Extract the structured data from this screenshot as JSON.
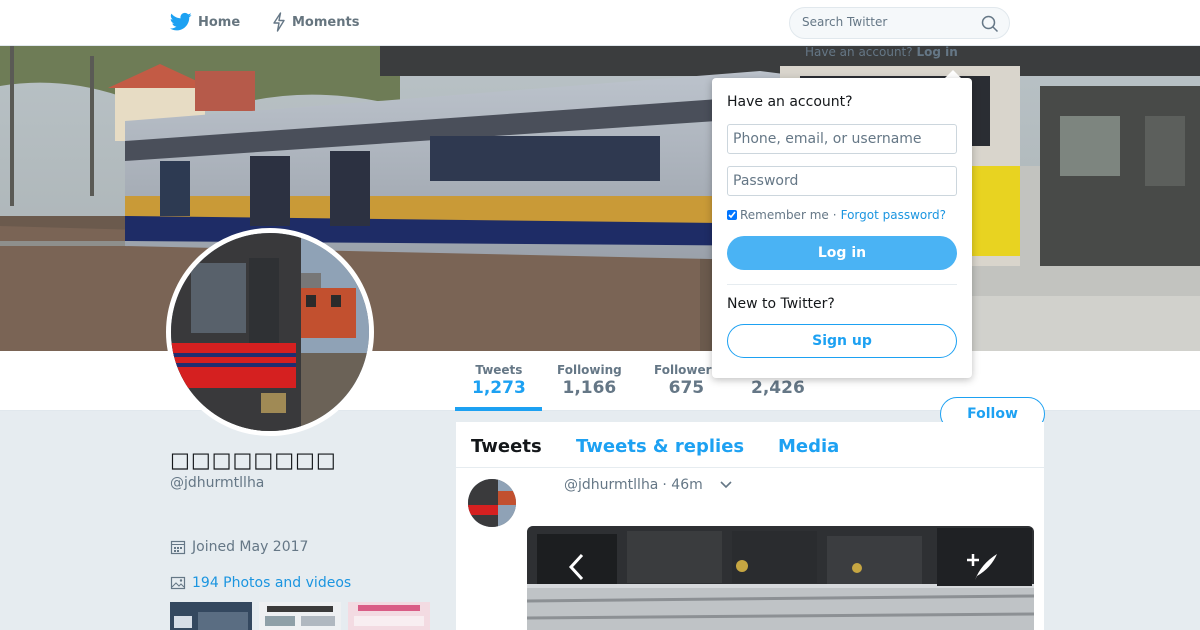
{
  "nav": {
    "home_label": "Home",
    "moments_label": "Moments",
    "search_placeholder": "Search Twitter",
    "have_account_prefix": "Have an account?",
    "login_link": "Log in"
  },
  "profile": {
    "display_name": "□□□□□□□□",
    "handle": "@jdhurmtllha",
    "joined": "Joined May 2017",
    "photos_link": "194 Photos and videos"
  },
  "stats": {
    "tweets_label": "Tweets",
    "tweets_value": "1,273",
    "following_label": "Following",
    "following_value": "1,166",
    "followers_label": "Followers",
    "followers_value": "675",
    "likes_value": "2,426"
  },
  "follow_label": "Follow",
  "timeline": {
    "tabs": [
      {
        "label": "Tweets"
      },
      {
        "label": "Tweets & replies"
      },
      {
        "label": "Media"
      }
    ],
    "tweet": {
      "handle": "@jdhurmtllha",
      "time": "· 46m"
    }
  },
  "login": {
    "title": "Have an account?",
    "user_placeholder": "Phone, email, or username",
    "password_placeholder": "Password",
    "remember_label": "Remember me",
    "separator": "·",
    "forgot_label": "Forgot password?",
    "login_button": "Log in",
    "new_to": "New to Twitter?",
    "signup_button": "Sign up"
  },
  "colors": {
    "accent": "#1da1f2",
    "login_button": "#4ab3f4",
    "link": "#1b95e0",
    "muted": "#657786",
    "background": "#e6ecf0"
  },
  "icons": {
    "home": "twitter-bird-icon",
    "moments": "lightning-icon",
    "search": "magnifier-icon",
    "calendar": "calendar-icon",
    "photos": "image-icon",
    "chevron": "chevron-down-icon",
    "prev": "chevron-left-icon",
    "compose": "compose-quill-icon"
  }
}
